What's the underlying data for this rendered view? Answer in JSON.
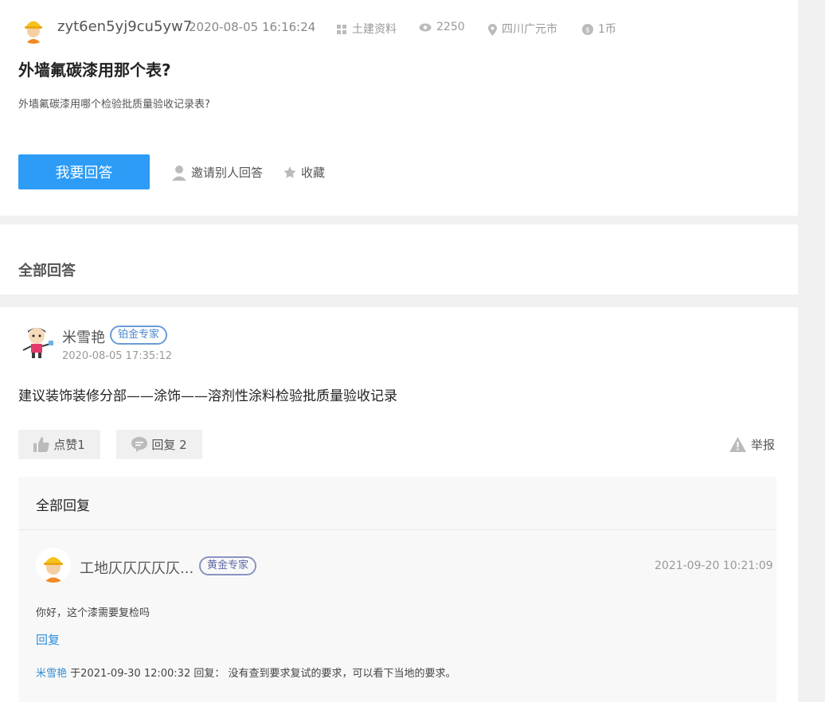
{
  "question": {
    "author": "zyt6en5yj9cu5yw7",
    "time": "2020-08-05 16:16:24",
    "category": "土建资料",
    "views": "2250",
    "location": "四川广元市",
    "reward": "1币",
    "title": "外墙氟碳漆用那个表?",
    "body": "外墙氟碳漆用哪个检验批质量验收记录表?",
    "answer_button": "我要回答",
    "invite_label": "邀请别人回答",
    "favorite_label": "收藏"
  },
  "answers_header": "全部回答",
  "answer": {
    "author": "米雪艳",
    "badge": "铂金专家",
    "time": "2020-08-05 17:35:12",
    "content": "建议装饰装修分部——涂饰——溶剂性涂料检验批质量验收记录",
    "like_label": "点赞1",
    "reply_label": "回复 2",
    "report_label": "举报",
    "replies_header": "全部回复",
    "reply": {
      "author": "工地仄仄仄仄仄...",
      "badge": "黄金专家",
      "time": "2021-09-20 10:21:09",
      "content": "你好，这个漆需要复检吗",
      "reply_link": "回复",
      "sub_author": "米雪艳",
      "sub_text": " 于2021-09-30 12:00:32 回复： 没有查到要求复试的要求，可以看下当地的要求。"
    }
  },
  "colors": {
    "primary": "#2d9cf6",
    "link": "#2f8fd8",
    "background": "#f1f1f1"
  }
}
